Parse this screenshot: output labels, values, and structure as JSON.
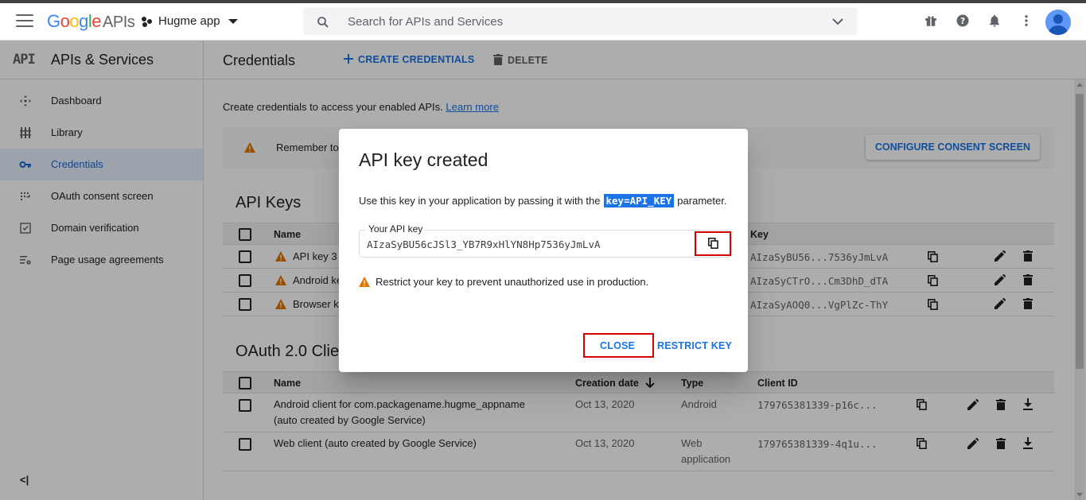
{
  "header": {
    "logo_google": "Google",
    "logo_apis": "APIs",
    "project": "Hugme app",
    "search_placeholder": "Search for APIs and Services"
  },
  "sidebar": {
    "title": "APIs & Services",
    "api_badge": "API",
    "items": [
      {
        "label": "Dashboard",
        "icon": "dashboard-icon"
      },
      {
        "label": "Library",
        "icon": "library-icon"
      },
      {
        "label": "Credentials",
        "icon": "key-icon",
        "active": true
      },
      {
        "label": "OAuth consent screen",
        "icon": "consent-icon"
      },
      {
        "label": "Domain verification",
        "icon": "domain-check-icon"
      },
      {
        "label": "Page usage agreements",
        "icon": "settings-list-icon"
      }
    ],
    "collapse_glyph": "<|"
  },
  "toolbar": {
    "title": "Credentials",
    "create": "CREATE CREDENTIALS",
    "delete": "DELETE"
  },
  "intro": {
    "text": "Create credentials to access your enabled APIs.",
    "link": "Learn more"
  },
  "banner": {
    "text": "Remember to",
    "button": "CONFIGURE CONSENT SCREEN"
  },
  "api_keys": {
    "title": "API Keys",
    "col_name": "Name",
    "col_key": "Key",
    "rows": [
      {
        "name": "API key 3",
        "key": "AIzaSyBU56...7536yJmLvA"
      },
      {
        "name": "Android ke",
        "key": "AIzaSyCTrO...Cm3DhD_dTA"
      },
      {
        "name": "Browser k",
        "key": "AIzaSyAOQ0...VgPlZc-ThY"
      }
    ]
  },
  "oauth": {
    "title": "OAuth 2.0 Clien",
    "col_name": "Name",
    "col_date": "Creation date",
    "col_type": "Type",
    "col_client": "Client ID",
    "rows": [
      {
        "name1": "Android client for com.packagename.hugme_appname",
        "name2": "(auto created by Google Service)",
        "date": "Oct 13, 2020",
        "type1": "Android",
        "type2": "",
        "client": "179765381339-p16c..."
      },
      {
        "name1": "Web client (auto created by Google Service)",
        "name2": "",
        "date": "Oct 13, 2020",
        "type1": "Web",
        "type2": "application",
        "client": "179765381339-4q1u..."
      }
    ]
  },
  "dialog": {
    "title": "API key created",
    "text_before": "Use this key in your application by passing it with the",
    "highlight": "key=API_KEY",
    "text_after": "parameter.",
    "field_label": "Your API key",
    "field_value": "AIzaSyBU56cJSl3_YB7R9xHlYN8Hp7536yJmLvA",
    "warning": "Restrict your key to prevent unauthorized use in production.",
    "close": "CLOSE",
    "restrict": "RESTRICT KEY"
  },
  "colors": {
    "accent": "#1a73e8",
    "warning": "#e37400",
    "highlight_box": "#d50000"
  }
}
